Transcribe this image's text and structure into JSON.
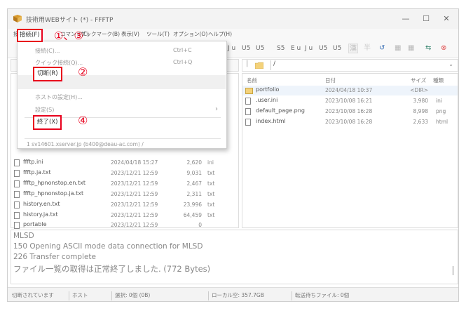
{
  "window": {
    "title": "技術用WEBサイト (*) - FFFTP",
    "controls": [
      "—",
      "☐",
      "✕"
    ]
  },
  "menu": {
    "items": [
      "接続(F)",
      "コマンド(C)",
      "ブックマーク(B)",
      "表示(V)",
      "ツール(T)",
      "オプション(O)",
      "ヘルプ(H)"
    ]
  },
  "toolbar": {
    "left_fragment": "u",
    "groups": [
      "J u",
      "U5",
      "U5",
      "S5",
      "E u",
      "J u",
      "U5",
      "U5"
    ],
    "icons": [
      "漢",
      "半",
      "↺",
      "▦",
      "▦",
      "⇆",
      "⊗"
    ]
  },
  "dropdown": {
    "items": [
      {
        "label": "接続(C)...",
        "shortcut": "Ctrl+C"
      },
      {
        "label": "クイック接続(Q)...",
        "shortcut": "Ctrl+Q"
      },
      {
        "label": "切断(R)"
      },
      {
        "label": "ホストの設定(H)..."
      },
      {
        "label": "設定(S)",
        "arrow": "›"
      },
      {
        "label": "終了(X)"
      }
    ],
    "history": "1 sv14601.xserver.jp (b400@deau-ac.com) /"
  },
  "annotations": {
    "connect_menu": "接続(F)",
    "connect_marker": "①、③",
    "disconnect_marker": "②",
    "exit_marker": "④"
  },
  "local": {
    "rows": [
      {
        "name": "ffftp.ini",
        "date": "2024/04/18 15:27",
        "size": "2,620",
        "type": "ini"
      },
      {
        "name": "ffftp.ja.txt",
        "date": "2023/12/21 12:59",
        "size": "9,031",
        "type": "txt"
      },
      {
        "name": "ffftp_hpnonstop.en.txt",
        "date": "2023/12/21 12:59",
        "size": "2,467",
        "type": "txt"
      },
      {
        "name": "ffftp_hpnonstop.ja.txt",
        "date": "2023/12/21 12:59",
        "size": "2,311",
        "type": "txt"
      },
      {
        "name": "history.en.txt",
        "date": "2023/12/21 12:59",
        "size": "23,996",
        "type": "txt"
      },
      {
        "name": "history.ja.txt",
        "date": "2023/12/21 12:59",
        "size": "64,459",
        "type": "txt"
      },
      {
        "name": "portable",
        "date": "2023/12/21 12:59",
        "size": "0",
        "type": ""
      }
    ]
  },
  "remote": {
    "path": "/",
    "headers": {
      "name": "名前",
      "date": "日付",
      "size": "サイズ",
      "type": "種類"
    },
    "rows": [
      {
        "name": "portfolio",
        "date": "2024/04/18 10:37",
        "size": "<DIR>",
        "type": "",
        "dir": true
      },
      {
        "name": ".user.ini",
        "date": "2023/10/08 16:21",
        "size": "3,980",
        "type": "ini"
      },
      {
        "name": "default_page.png",
        "date": "2023/10/08 16:28",
        "size": "8,998",
        "type": "png"
      },
      {
        "name": "index.html",
        "date": "2023/10/08 16:28",
        "size": "2,633",
        "type": "html"
      }
    ]
  },
  "log": {
    "lines": [
      "MLSD",
      "150 Opening ASCII mode data connection for MLSD",
      "226 Transfer complete",
      "ファイル一覧の取得は正常終了しました. (772 Bytes)"
    ]
  },
  "status": {
    "connection": "切断されています",
    "host": "ホスト",
    "selected": "選択: 0個 (0B)",
    "local_free": "ローカル空: 357.7GB",
    "pending": "転送待ちファイル: 0個"
  }
}
